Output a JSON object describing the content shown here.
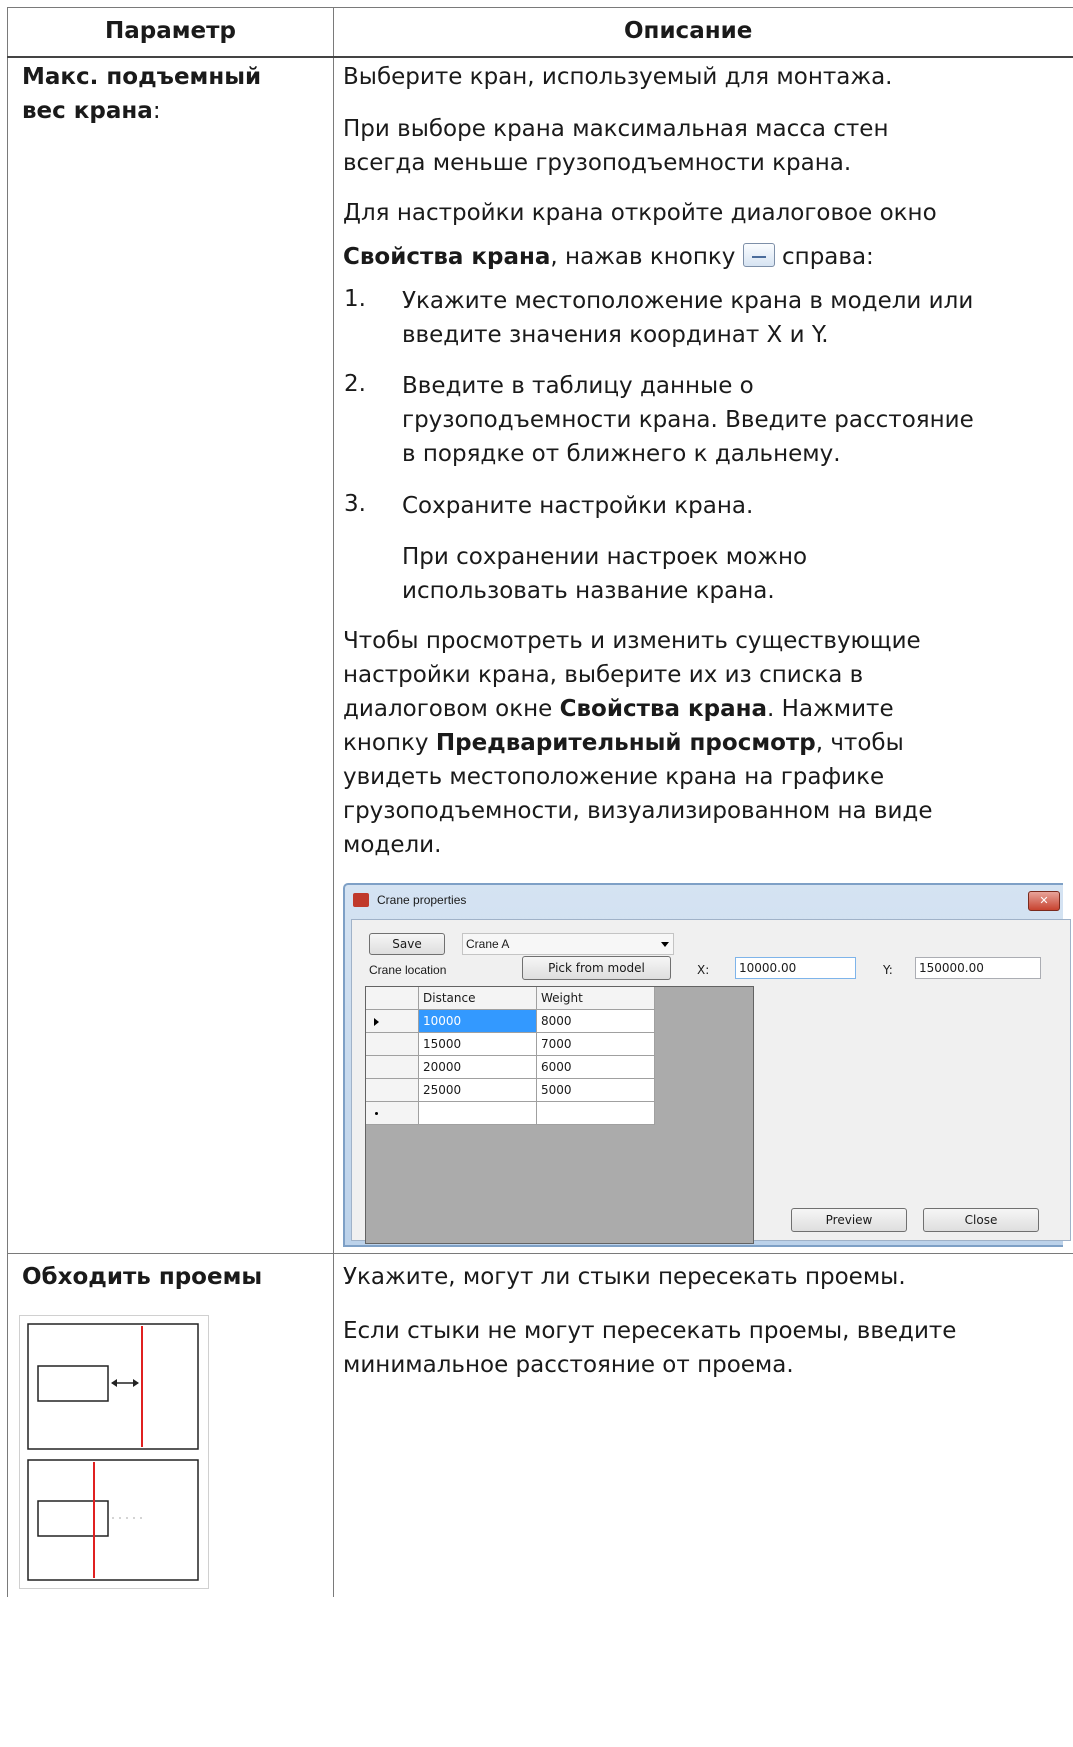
{
  "table": {
    "header": {
      "param": "Параметр",
      "desc": "Описание"
    },
    "row1": {
      "param_line1": "Макс. подъемный",
      "param_line2_bold": "вес крана",
      "param_line2_tail": ":",
      "p1": "Выберите кран, используемый для монтажа.",
      "p2_l1": "При выборе крана максимальная масса стен",
      "p2_l2": "всегда меньше грузоподъемности крана.",
      "p3_l1": "Для настройки крана откройте диалоговое окно",
      "p3_l2_bold": "Свойства крана",
      "p3_l2_a": ", нажав кнопку",
      "p3_l2_b": "справа:",
      "steps": [
        {
          "num": "1.",
          "l1": "Укажите местоположение крана в модели или",
          "l2": "введите значения координат X и Y."
        },
        {
          "num": "2.",
          "l1": "Введите в таблицу данные о",
          "l2": "грузоподъемности крана. Введите расстояние",
          "l3": "в порядке от ближнего к дальнему."
        },
        {
          "num": "3.",
          "l1": "Сохраните настройки крана."
        }
      ],
      "note_l1": "При сохранении настроек можно",
      "note_l2": "использовать название крана.",
      "p4_l1": "Чтобы просмотреть и изменить существующие",
      "p4_l2": "настройки крана, выберите их из списка в",
      "p4_l3_a": "диалоговом окне ",
      "p4_l3_bold": "Свойства крана",
      "p4_l3_b": ". Нажмите",
      "p4_l4_a": "кнопку ",
      "p4_l4_bold": "Предварительный просмотр",
      "p4_l4_b": ", чтобы",
      "p4_l5": "увидеть местоположение крана на графике",
      "p4_l6": "грузоподъемности, визуализированном на виде",
      "p4_l7": "модели."
    },
    "row2": {
      "param": "Обходить проемы",
      "p1": "Укажите, могут ли стыки пересекать проемы.",
      "p2_l1": "Если стыки не могут пересекать проемы, введите",
      "p2_l2": "минимальное расстояние от проема."
    }
  },
  "dialog": {
    "title": "Crane properties",
    "save_label": "Save",
    "crane_select": "Crane A",
    "crane_location_label": "Crane location",
    "pick_label": "Pick from model",
    "x_label": "X:",
    "x_value": "10000.00",
    "y_label": "Y:",
    "y_value": "150000.00",
    "columns": [
      "Distance",
      "Weight"
    ],
    "rows": [
      [
        "10000",
        "8000"
      ],
      [
        "15000",
        "7000"
      ],
      [
        "20000",
        "6000"
      ],
      [
        "25000",
        "5000"
      ]
    ],
    "preview_label": "Preview",
    "close_label": "Close",
    "close_x": "✕"
  }
}
